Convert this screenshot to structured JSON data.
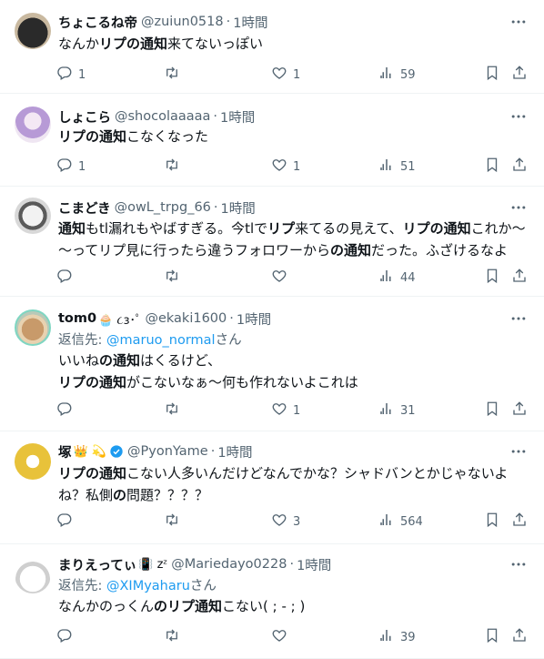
{
  "icons": {
    "reply": "reply-icon",
    "retweet": "retweet-icon",
    "like": "heart-icon",
    "views": "views-icon",
    "bookmark": "bookmark-icon",
    "share": "share-icon",
    "more": "more-icon",
    "verified": "verified-badge-icon"
  },
  "colors": {
    "link": "#1d9bf0",
    "secondary": "#536471",
    "text": "#0f1419",
    "divider": "#eff3f4"
  },
  "tweets": [
    {
      "name": "ちょこるね帝",
      "handle": "@zuiun0518",
      "time": "1時間",
      "segments": [
        [
          [
            "なんか",
            false
          ],
          [
            "リプの通知",
            true
          ],
          [
            "来てないっぽい",
            false
          ]
        ]
      ],
      "reply_count": "1",
      "retweet_count": "",
      "like_count": "1",
      "view_count": "59"
    },
    {
      "name": "しょこら",
      "handle": "@shocolaaaaa",
      "time": "1時間",
      "segments": [
        [
          [
            "リプの通知",
            true
          ],
          [
            "こなくなった",
            false
          ]
        ]
      ],
      "reply_count": "1",
      "retweet_count": "",
      "like_count": "1",
      "view_count": "51"
    },
    {
      "name": "こまどき",
      "handle": "@owL_trpg_66",
      "time": "1時間",
      "segments": [
        [
          [
            "通知",
            true
          ],
          [
            "もtl漏れもやばすぎる。今tlで",
            false
          ],
          [
            "リプ",
            true
          ],
          [
            "来てるの見えて、",
            false
          ],
          [
            "リプの通知",
            true
          ],
          [
            "これか～",
            false
          ]
        ],
        [
          [
            "～ってリプ",
            false
          ],
          [
            "見に行ったら違うフォロワーから",
            false
          ],
          [
            "の通知",
            true
          ],
          [
            "だった。ふざけるなよ",
            false
          ]
        ]
      ],
      "reply_count": "",
      "retweet_count": "",
      "like_count": "",
      "view_count": "44"
    },
    {
      "name": "tom0",
      "name_emoji": "🧁 ૮з･ﾟ",
      "handle": "@ekaki1600",
      "time": "1時間",
      "reply_label": "返信先: ",
      "reply_handle": "@maruo_normal",
      "reply_suffix": "さん",
      "segments": [
        [
          [
            "いいね",
            false
          ],
          [
            "の通知",
            true
          ],
          [
            "はくるけど、",
            false
          ]
        ],
        [
          [
            "リプの通知",
            true
          ],
          [
            "がこないなぁ～何も作れないよこれは",
            false
          ]
        ]
      ],
      "reply_count": "",
      "retweet_count": "",
      "like_count": "1",
      "view_count": "31"
    },
    {
      "name": "塚",
      "name_emoji": "👑 💫",
      "handle": "@PyonYame",
      "time": "1時間",
      "verified": true,
      "segments": [
        [
          [
            "リプの通知",
            true
          ],
          [
            "こない人多いんだけどなんでかな？シャドバンとかじゃないよ",
            false
          ]
        ],
        [
          [
            "ね？私側",
            false
          ],
          [
            "の",
            true
          ],
          [
            "問題？？？？",
            false
          ]
        ]
      ],
      "reply_count": "",
      "retweet_count": "",
      "like_count": "3",
      "view_count": "564"
    },
    {
      "name": "まりえってぃ",
      "name_emoji": "📳 zᶻ",
      "handle": "@Mariedayo0228",
      "time": "1時間",
      "reply_label": "返信先: ",
      "reply_handle": "@XIMyaharu",
      "reply_suffix": "さん",
      "segments": [
        [
          [
            "なんかのっくん",
            false
          ],
          [
            "のリプ通知",
            true
          ],
          [
            "こない( ; - ; )",
            false
          ]
        ]
      ],
      "reply_count": "",
      "retweet_count": "",
      "like_count": "",
      "view_count": "39"
    }
  ]
}
